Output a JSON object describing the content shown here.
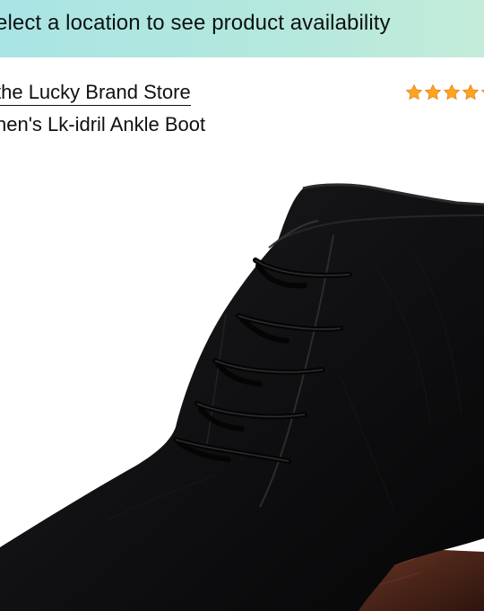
{
  "banner": {
    "text": "elect a location to see product availability"
  },
  "product": {
    "store_link": "the Lucky Brand Store",
    "title": "nen's Lk-idril Ankle Boot"
  },
  "rating": {
    "star_color": "#ffa41c",
    "visible_stars": 5
  },
  "image": {
    "subject": "boot-image"
  }
}
